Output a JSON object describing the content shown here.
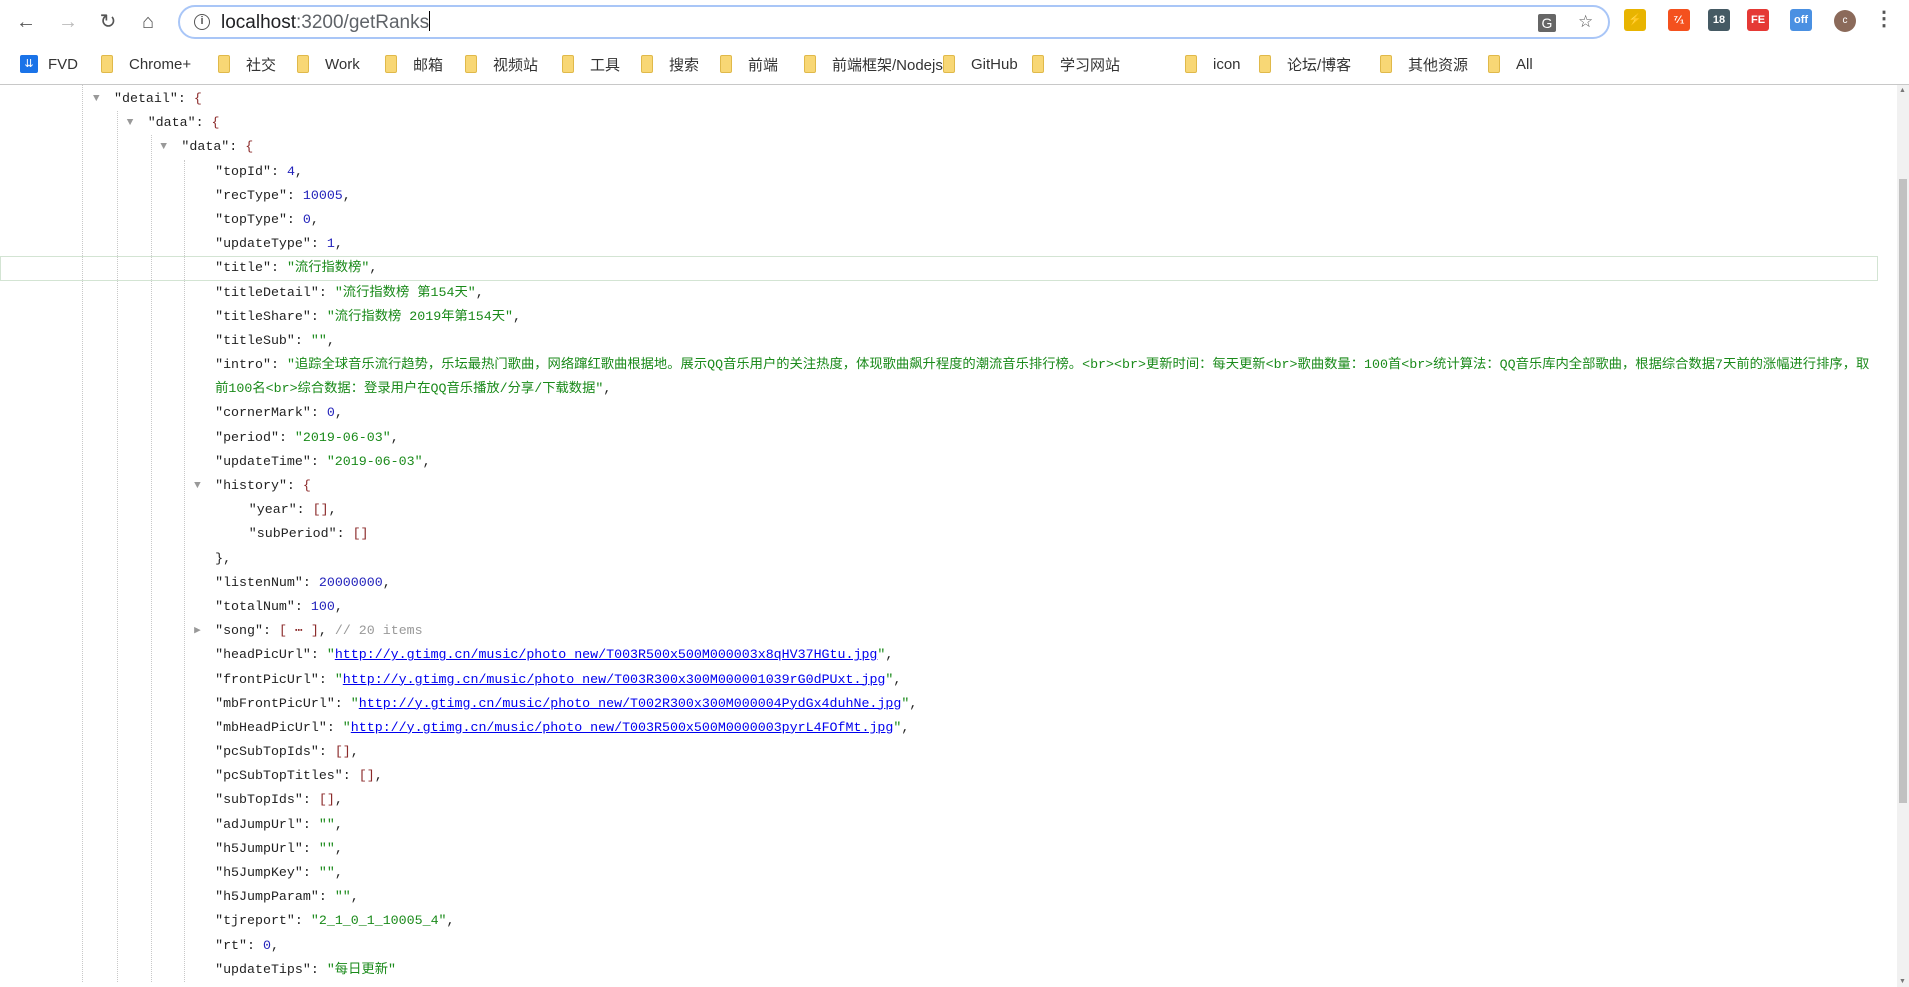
{
  "browser": {
    "url_host": "localhost",
    "url_path": ":3200/getRanks",
    "extensions": [
      {
        "name": "lightning",
        "color": "#e8b400",
        "label": "⚡"
      },
      {
        "name": "yapi",
        "color": "#f4511e",
        "label": "⁷⁄₁"
      },
      {
        "name": "extension-18",
        "color": "#455a64",
        "label": "18"
      },
      {
        "name": "fe",
        "color": "#e53935",
        "label": "FE"
      },
      {
        "name": "off",
        "color": "#4a90e2",
        "label": "off"
      }
    ],
    "avatar_initial": "c"
  },
  "bookmarks": [
    {
      "label": "FVD",
      "icon": "fvd-icon"
    },
    {
      "label": "Chrome+",
      "icon": "folder-icon"
    },
    {
      "label": "社交",
      "icon": "folder-icon"
    },
    {
      "label": "Work",
      "icon": "folder-icon"
    },
    {
      "label": "邮箱",
      "icon": "folder-icon"
    },
    {
      "label": "视频站",
      "icon": "folder-icon"
    },
    {
      "label": "工具",
      "icon": "folder-icon"
    },
    {
      "label": "搜索",
      "icon": "folder-icon"
    },
    {
      "label": "前端",
      "icon": "folder-icon"
    },
    {
      "label": "前端框架/Nodejs",
      "icon": "folder-icon"
    },
    {
      "label": "GitHub",
      "icon": "folder-icon"
    },
    {
      "label": "学习网站",
      "icon": "folder-icon"
    },
    {
      "label": "icon",
      "icon": "folder-icon"
    },
    {
      "label": "论坛/博客",
      "icon": "folder-icon"
    },
    {
      "label": "其他资源",
      "icon": "folder-icon"
    },
    {
      "label": "All",
      "icon": "folder-icon"
    }
  ],
  "json_lines": [
    {
      "lvl": 0,
      "tog": "down",
      "key": "detail",
      "open": "{"
    },
    {
      "lvl": 1,
      "tog": "down",
      "key": "data",
      "open": "{"
    },
    {
      "lvl": 2,
      "tog": "down",
      "key": "data",
      "open": "{"
    },
    {
      "lvl": 3,
      "key": "topId",
      "val": "4",
      "t": "n",
      "comma": true
    },
    {
      "lvl": 3,
      "key": "recType",
      "val": "10005",
      "t": "n",
      "comma": true
    },
    {
      "lvl": 3,
      "key": "topType",
      "val": "0",
      "t": "n",
      "comma": true
    },
    {
      "lvl": 3,
      "key": "updateType",
      "val": "1",
      "t": "n",
      "comma": true
    },
    {
      "lvl": 3,
      "key": "title",
      "val": "\"流行指数榜\"",
      "t": "s",
      "comma": true,
      "hl": true
    },
    {
      "lvl": 3,
      "key": "titleDetail",
      "val": "\"流行指数榜 第154天\"",
      "t": "s",
      "comma": true
    },
    {
      "lvl": 3,
      "key": "titleShare",
      "val": "\"流行指数榜 2019年第154天\"",
      "t": "s",
      "comma": true
    },
    {
      "lvl": 3,
      "key": "titleSub",
      "val": "\"\"",
      "t": "s",
      "comma": true
    },
    {
      "lvl": 3,
      "key": "intro",
      "val": "\"追踪全球音乐流行趋势，乐坛最热门歌曲，网络蹿红歌曲根据地。展示QQ音乐用户的关注热度，体现歌曲飙升程度的潮流音乐排行榜。<br><br>更新时间：每天更新<br>歌曲数量：100首<br>统计算法：QQ音乐库内全部歌曲，根据综合数据7天前的涨幅进行排序，取前100名<br>综合数据：登录用户在QQ音乐播放/分享/下载数据\"",
      "t": "s",
      "comma": true
    },
    {
      "lvl": 3,
      "key": "cornerMark",
      "val": "0",
      "t": "n",
      "comma": true
    },
    {
      "lvl": 3,
      "key": "period",
      "val": "\"2019-06-03\"",
      "t": "s",
      "comma": true
    },
    {
      "lvl": 3,
      "key": "updateTime",
      "val": "\"2019-06-03\"",
      "t": "s",
      "comma": true
    },
    {
      "lvl": 3,
      "tog": "down",
      "key": "history",
      "open": "{"
    },
    {
      "lvl": 4,
      "key": "year",
      "val": "[]",
      "t": "b",
      "comma": true
    },
    {
      "lvl": 4,
      "key": "subPeriod",
      "val": "[]",
      "t": "b"
    },
    {
      "lvl": 3,
      "close": "},"
    },
    {
      "lvl": 3,
      "key": "listenNum",
      "val": "20000000",
      "t": "n",
      "comma": true
    },
    {
      "lvl": 3,
      "key": "totalNum",
      "val": "100",
      "t": "n",
      "comma": true
    },
    {
      "lvl": 3,
      "tog": "right",
      "key": "song",
      "val": "[ ⋯ ]",
      "t": "b",
      "comma": true,
      "comment": "// 20 items"
    },
    {
      "lvl": 3,
      "key": "headPicUrl",
      "val": "http://y.gtimg.cn/music/photo_new/T003R500x500M000003x8qHV37HGtu.jpg",
      "t": "u",
      "comma": true
    },
    {
      "lvl": 3,
      "key": "frontPicUrl",
      "val": "http://y.gtimg.cn/music/photo_new/T003R300x300M000001039rG0dPUxt.jpg",
      "t": "u",
      "comma": true
    },
    {
      "lvl": 3,
      "key": "mbFrontPicUrl",
      "val": "http://y.gtimg.cn/music/photo_new/T002R300x300M000004PydGx4duhNe.jpg",
      "t": "u",
      "comma": true
    },
    {
      "lvl": 3,
      "key": "mbHeadPicUrl",
      "val": "http://y.gtimg.cn/music/photo_new/T003R500x500M0000003pyrL4FOfMt.jpg",
      "t": "u",
      "comma": true
    },
    {
      "lvl": 3,
      "key": "pcSubTopIds",
      "val": "[]",
      "t": "b",
      "comma": true
    },
    {
      "lvl": 3,
      "key": "pcSubTopTitles",
      "val": "[]",
      "t": "b",
      "comma": true
    },
    {
      "lvl": 3,
      "key": "subTopIds",
      "val": "[]",
      "t": "b",
      "comma": true
    },
    {
      "lvl": 3,
      "key": "adJumpUrl",
      "val": "\"\"",
      "t": "s",
      "comma": true
    },
    {
      "lvl": 3,
      "key": "h5JumpUrl",
      "val": "\"\"",
      "t": "s",
      "comma": true
    },
    {
      "lvl": 3,
      "key": "h5JumpKey",
      "val": "\"\"",
      "t": "s",
      "comma": true
    },
    {
      "lvl": 3,
      "key": "h5JumpParam",
      "val": "\"\"",
      "t": "s",
      "comma": true
    },
    {
      "lvl": 3,
      "key": "tjreport",
      "val": "\"2_1_0_1_10005_4\"",
      "t": "s",
      "comma": true
    },
    {
      "lvl": 3,
      "key": "rt",
      "val": "0",
      "t": "n",
      "comma": true
    },
    {
      "lvl": 3,
      "key": "updateTips",
      "val": "\"每日更新\"",
      "t": "s"
    }
  ]
}
